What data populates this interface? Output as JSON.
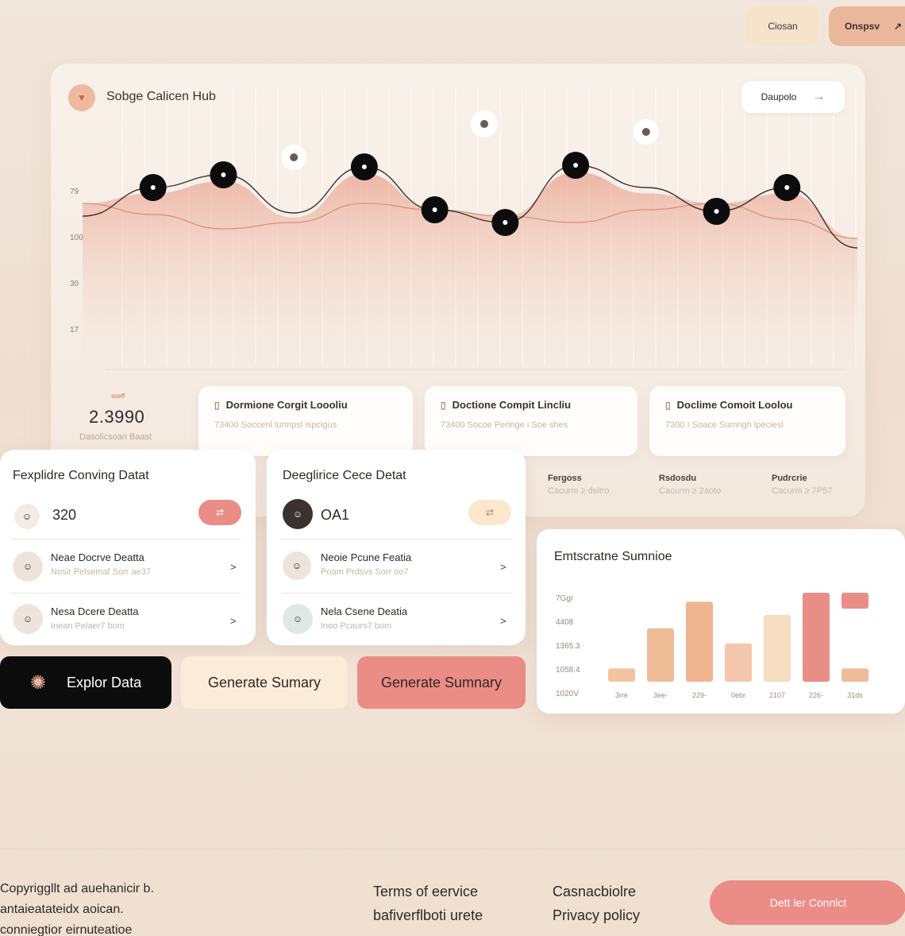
{
  "top_buttons": {
    "first": "Ciosan",
    "second": "Onspsv",
    "second_arrow": "↗"
  },
  "hub": {
    "title": "Sobge Calicen Hub",
    "button": "Daupolo",
    "button_arrow": "→"
  },
  "colors": {
    "accent": "#eb8c86",
    "peach": "#f1b8a0",
    "dark": "#0d0c0c"
  },
  "kpi": {
    "small_label": "soeff",
    "value": "2.3990",
    "sub": "Dasolicsoan Baast"
  },
  "doc_cards": [
    {
      "title": "Dormione Corgit Loooliu",
      "sub": "73400 Soccenl lurmpsl ispcigus"
    },
    {
      "title": "Doctione Compit Lincliu",
      "sub": "73400 Socoe Peringe i Soe shes"
    },
    {
      "title": "Doclime Comoit Loolou",
      "sub": "7300 I Soace Sumngh lpeciesl"
    }
  ],
  "stats": [
    {
      "label": "Fergoss",
      "sub": "Cacurm ≥ dsitro"
    },
    {
      "label": "Rsdosdu",
      "sub": "Cacurm ≥ 2aoto"
    },
    {
      "label": "Pudrcrie",
      "sub": "Cacurm ≥ 7P57"
    }
  ],
  "list_cards": [
    {
      "title": "Fexplidre Conving Datat",
      "count": "320",
      "badge": "⇄",
      "rows": [
        {
          "title": "Neae Docrve Deatta",
          "sub": "Nosir Pelsemaf Sorr ae37",
          "chevron": ">"
        },
        {
          "title": "Nesa Dcere Deatta",
          "sub": "Inean Pelaer7 bom",
          "chevron": ">"
        }
      ]
    },
    {
      "title": "Deeglirice Cece Detat",
      "count": "OA1",
      "badge": "⇄",
      "rows": [
        {
          "title": "Neoie Pcune Featia",
          "sub": "Poam Prdsvs Sorr oo7",
          "chevron": ">"
        },
        {
          "title": "Nela Csene Deatia",
          "sub": "Inoo Pcaurs7 bom",
          "chevron": ">"
        }
      ]
    }
  ],
  "actions": {
    "explore": "Explor Data",
    "generate_1": "Generate Sumary",
    "generate_2": "Generate Sumnary"
  },
  "summary": {
    "title": "Emtscratne Sumnioe",
    "y_labels": [
      "7Ggr",
      "4408",
      "1365.3",
      "1058.4",
      "1020V"
    ],
    "x_labels": [
      "3rre",
      "3ee-",
      "229-",
      "0ebr",
      "2107",
      "226-",
      "31ds"
    ]
  },
  "chart_data": {
    "type": "bar",
    "title": "Emtscratne Sumnioe",
    "categories": [
      "3rre",
      "3ee-",
      "229-",
      "0ebr",
      "2107",
      "226-",
      "31ds"
    ],
    "series": [
      {
        "values": [
          0.15,
          0.6,
          0.9,
          0.43,
          0.75,
          1.0,
          0.15
        ]
      },
      {
        "values": [
          0,
          0,
          0,
          0,
          0,
          0,
          0.12
        ]
      }
    ],
    "xlabel": "",
    "ylabel": ""
  },
  "hub_chart": {
    "y_labels": [
      "79",
      "100",
      "30",
      "17"
    ],
    "line_points": [
      0.54,
      0.72,
      0.8,
      0.56,
      0.85,
      0.58,
      0.5,
      0.86,
      0.72,
      0.57,
      0.72,
      0.34
    ],
    "secondary_points": [
      0.62,
      0.55,
      0.46,
      0.5,
      0.62,
      0.58,
      0.54,
      0.5,
      0.58,
      0.62,
      0.52,
      0.4
    ]
  },
  "footer": {
    "lines": [
      "Copyriggllt ad auehanicir b.",
      "antaieatateidx aoican.",
      "conniegtior eirnuteatioe"
    ],
    "terms": "Terms of eervice",
    "terms_sub": "bafiverflboti urete",
    "contact": "Casnacbiolre",
    "privacy": "Privacy policy",
    "cta": "Dett ler Connlct"
  }
}
